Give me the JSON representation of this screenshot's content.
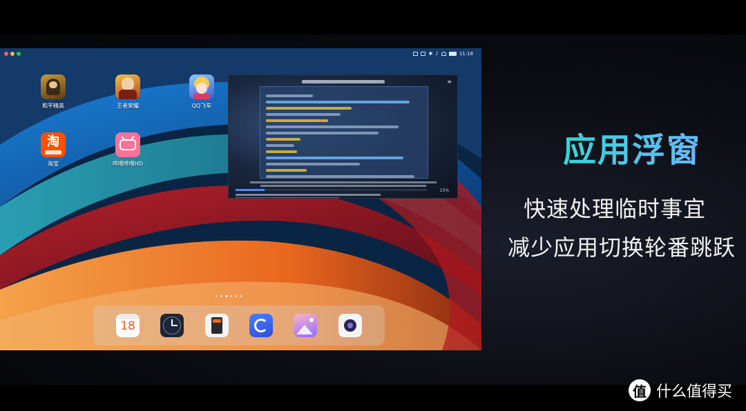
{
  "statusbar": {
    "time": "11:18"
  },
  "window_controls": {
    "colors": [
      "#ff5f57",
      "#febc2e",
      "#28c840"
    ]
  },
  "apps": [
    {
      "label": "和平精英",
      "icon": "peace-elite-icon"
    },
    {
      "label": "王者荣耀",
      "icon": "honor-of-kings-icon"
    },
    {
      "label": "QQ飞车",
      "icon": "qq-speed-icon"
    },
    {
      "label": "淘宝",
      "icon": "taobao-icon"
    },
    {
      "label": "哔哩哔哩HD",
      "icon": "bilibili-icon"
    }
  ],
  "floating_window": {
    "progress_percent": 15,
    "progress_label": "15%"
  },
  "dock": {
    "items": [
      {
        "icon": "calendar-icon",
        "text": "18"
      },
      {
        "icon": "clock-icon"
      },
      {
        "icon": "calculator-icon"
      },
      {
        "icon": "browser-icon"
      },
      {
        "icon": "gallery-icon"
      },
      {
        "icon": "camera-icon"
      }
    ]
  },
  "promo": {
    "headline": "应用浮窗",
    "line1": "快速处理临时事宜",
    "line2": "减少应用切换轮番跳跃"
  },
  "watermark": {
    "logo": "值",
    "text": "什么值得买"
  }
}
